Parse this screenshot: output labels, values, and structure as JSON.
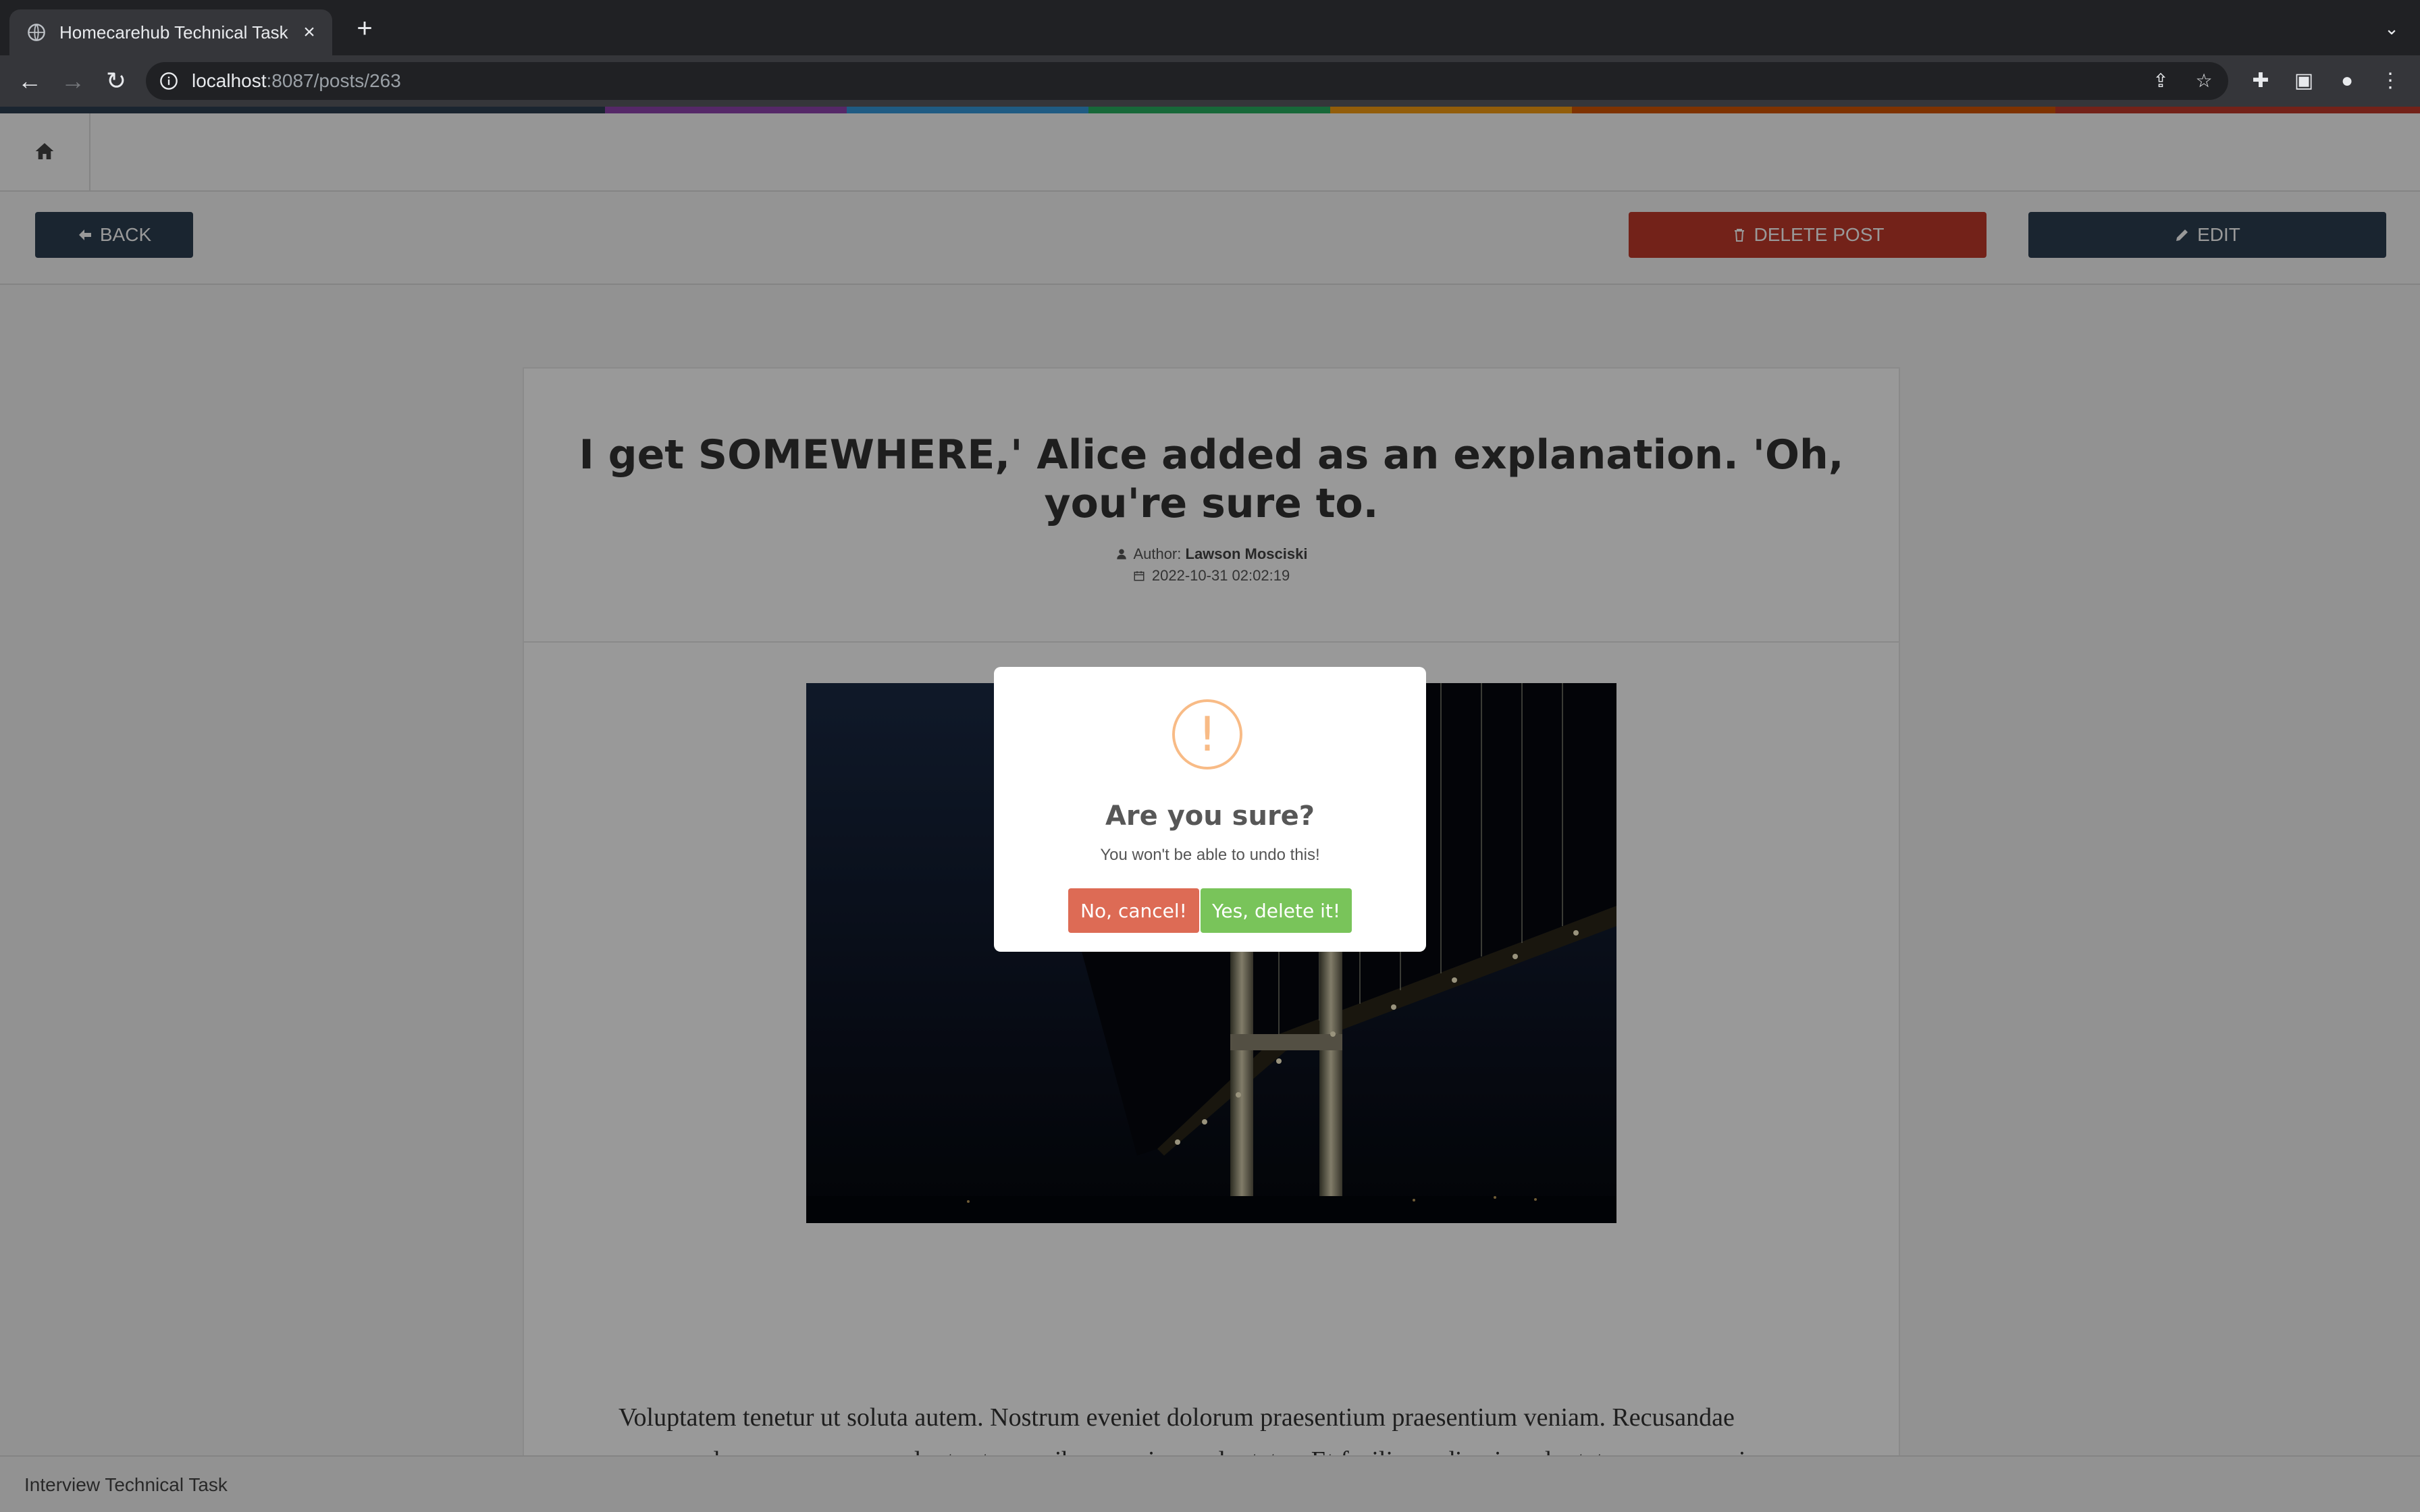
{
  "browser": {
    "tab_title": "Homecarehub Technical Task",
    "url_host": "localhost",
    "url_path": ":8087/posts/263"
  },
  "rainbow_colors": [
    "#2c3e50",
    "#8e44ad",
    "#3498db",
    "#27ae60",
    "#f39c12",
    "#d35400",
    "#c0392b"
  ],
  "actions": {
    "back_label": "BACK",
    "delete_label": "DELETE POST",
    "edit_label": "EDIT"
  },
  "post": {
    "title": "I get SOMEWHERE,' Alice added as an explanation. 'Oh, you're sure to.",
    "author_label": "Author:",
    "author_name": "Lawson Mosciski",
    "date": "2022-10-31 02:02:19",
    "body": "Voluptatem tenetur ut soluta autem. Nostrum eveniet dolorum praesentium praesentium veniam. Recusandae assumenda saepe cumque voluptas temporibus aperiam voluptates. Et facilis modi quia voluptate saepe asperiores."
  },
  "footer": {
    "text": "Interview Technical Task"
  },
  "modal": {
    "icon_glyph": "!",
    "title": "Are you sure?",
    "text": "You won't be able to undo this!",
    "cancel_label": "No, cancel!",
    "confirm_label": "Yes, delete it!"
  },
  "colors": {
    "back_button": "#2c3e50",
    "delete_button": "#c0392b",
    "cancel_button": "#dd6b55",
    "confirm_button": "#79c45a",
    "warning_icon": "#f8bb86"
  }
}
